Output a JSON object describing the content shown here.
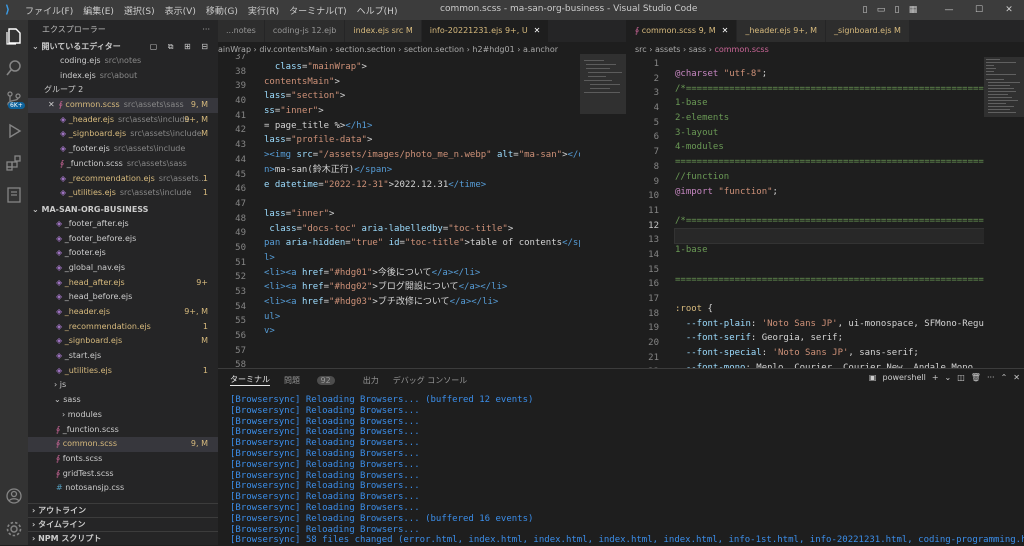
{
  "titlebar": {
    "menu": [
      "ファイル(F)",
      "編集(E)",
      "選択(S)",
      "表示(V)",
      "移動(G)",
      "実行(R)",
      "ターミナル(T)",
      "ヘルプ(H)"
    ],
    "title": "common.scss - ma-san-org-business - Visual Studio Code"
  },
  "activity": {
    "icons": [
      "files-icon",
      "search-icon",
      "source-control-icon",
      "run-icon",
      "extensions-icon",
      "remote-icon",
      "account-icon",
      "settings-icon"
    ],
    "scm_badge": "6K+"
  },
  "sidebar": {
    "header": "エクスプローラー",
    "open_editors": "開いているエディター",
    "open_items": [
      {
        "name": "coding.ejs",
        "hint": "src\\notes"
      },
      {
        "name": "index.ejs",
        "hint": "src\\about"
      }
    ],
    "group2": "グループ 2",
    "group_items": [
      {
        "name": "common.scss",
        "hint": "src\\assets\\sass",
        "badge": "9, M",
        "close": "✕"
      },
      {
        "name": "_header.ejs",
        "hint": "src\\assets\\include",
        "badge": "9+, M"
      },
      {
        "name": "_signboard.ejs",
        "hint": "src\\assets\\include",
        "badge": "M"
      },
      {
        "name": "_footer.ejs",
        "hint": "src\\assets\\include",
        "badge": ""
      },
      {
        "name": "_function.scss",
        "hint": "src\\assets\\sass",
        "badge": ""
      },
      {
        "name": "_recommendation.ejs",
        "hint": "src\\assets...",
        "badge": "1"
      },
      {
        "name": "_utilities.ejs",
        "hint": "src\\assets\\include",
        "badge": "1"
      }
    ],
    "project": "MA-SAN-ORG-BUSINESS",
    "tree": [
      {
        "name": "_footer_after.ejs",
        "badge": ""
      },
      {
        "name": "_footer_before.ejs",
        "badge": ""
      },
      {
        "name": "_footer.ejs",
        "badge": ""
      },
      {
        "name": "_global_nav.ejs",
        "badge": ""
      },
      {
        "name": "_head_after.ejs",
        "badge": "9+"
      },
      {
        "name": "_head_before.ejs",
        "badge": ""
      },
      {
        "name": "_header.ejs",
        "badge": "9+, M"
      },
      {
        "name": "_recommendation.ejs",
        "badge": "1"
      },
      {
        "name": "_signboard.ejs",
        "badge": "M"
      },
      {
        "name": "_start.ejs",
        "badge": ""
      },
      {
        "name": "_utilities.ejs",
        "badge": "1"
      }
    ],
    "folders": {
      "js": "js",
      "sass": "sass",
      "modules": "modules"
    },
    "sass_files": [
      {
        "name": "_function.scss",
        "badge": ""
      },
      {
        "name": "common.scss",
        "badge": "9, M"
      },
      {
        "name": "fonts.scss",
        "badge": ""
      },
      {
        "name": "gridTest.scss",
        "badge": ""
      },
      {
        "name": "notosansjp.css",
        "badge": ""
      }
    ],
    "outline": "アウトライン",
    "timeline": "タイムライン",
    "npm": "NPM スクリプト"
  },
  "left_editor": {
    "tabs": [
      {
        "label": "...notes"
      },
      {
        "label": "coding-js 12.ejb"
      },
      {
        "label": "index.ejs",
        "hint": "src M"
      },
      {
        "label": "info-20221231.ejs",
        "hint": "9+, U",
        "close": "✕"
      }
    ],
    "breadcrumb": [
      "ainWrap",
      "div.contentsMain",
      "section.section",
      "section.section",
      "h2#hdg01",
      "a.anchor"
    ],
    "line_numbers": [
      "37",
      "38",
      "39",
      "40",
      "41",
      "42",
      "43",
      "44",
      "45",
      "46",
      "47",
      "48",
      "49",
      "50",
      "51",
      "52",
      "53",
      "54",
      "55",
      "56",
      "57",
      "58",
      "59",
      "60",
      "61"
    ]
  },
  "right_editor": {
    "tabs": [
      {
        "label": "common.scss",
        "hint": "9, M",
        "close": "✕"
      },
      {
        "label": "_header.ejs",
        "hint": "9+, M"
      },
      {
        "label": "_signboard.ejs",
        "hint": "M"
      }
    ],
    "breadcrumb": [
      "src",
      "assets",
      "sass",
      "common.scss"
    ],
    "line_numbers": [
      "1",
      "2",
      "3",
      "4",
      "5",
      "6",
      "7",
      "8",
      "9",
      "10",
      "11",
      "12",
      "13",
      "14",
      "15",
      "16",
      "17",
      "18",
      "19",
      "20",
      "21",
      "22",
      "23",
      "24"
    ]
  },
  "panel": {
    "tabs": [
      "ターミナル",
      "問題",
      "出力",
      "デバッグ コンソール"
    ],
    "problem_count": "92",
    "shell": "powershell",
    "lines": [
      "[Browsersync] Reloading Browsers... (buffered 12 events)",
      "[Browsersync] Reloading Browsers...",
      "[Browsersync] Reloading Browsers...",
      "[Browsersync] Reloading Browsers...",
      "[Browsersync] Reloading Browsers...",
      "[Browsersync] Reloading Browsers...",
      "[Browsersync] Reloading Browsers...",
      "[Browsersync] Reloading Browsers...",
      "[Browsersync] Reloading Browsers...",
      "[Browsersync] Reloading Browsers...",
      "[Browsersync] Reloading Browsers...",
      "[Browsersync] Reloading Browsers... (buffered 16 events)",
      "[Browsersync] Reloading Browsers...",
      "[Browsersync] 58 files changed (error.html, index.html, index.html, index.html, index.html, info-1st.html, info-20221231.html, coding-programming.html,"
    ]
  }
}
